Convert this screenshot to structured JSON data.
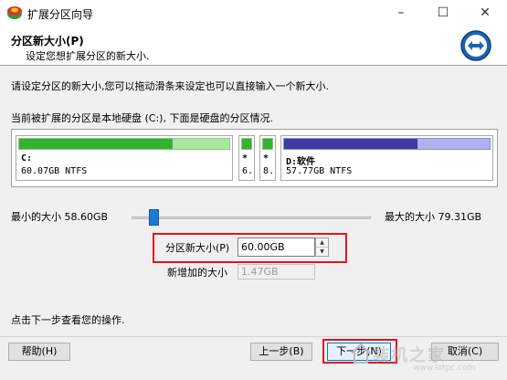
{
  "window": {
    "title": "扩展分区向导"
  },
  "titlebar_buttons": {
    "minimize": "–",
    "maximize": "☐",
    "close": "✕"
  },
  "header": {
    "title": "分区新大小(P)",
    "subtitle": "设定您想扩展分区的新大小."
  },
  "content": {
    "instruction": "请设定分区的新大小,您可以拖动滑条来设定也可以直接输入一个新大小.",
    "status": "当前被扩展的分区是本地硬盘 (C:), 下面是硬盘的分区情况.",
    "footer_note": "点击下一步查看您的操作."
  },
  "partitions": [
    {
      "name": "C:",
      "info": "60.07GB NTFS",
      "used_pct": 73,
      "color": "green"
    },
    {
      "name": "*",
      "info": "6.",
      "used_pct": 100,
      "color": "green"
    },
    {
      "name": "*",
      "info": "8.",
      "used_pct": 100,
      "color": "green"
    },
    {
      "name": "D:软件",
      "info": "57.77GB NTFS",
      "used_pct": 65,
      "color": "blue"
    }
  ],
  "slider": {
    "min_label": "最小的大小 58.60GB",
    "max_label": "最大的大小 79.31GB"
  },
  "size": {
    "label": "分区新大小(P)",
    "value": "60.00GB",
    "added_label": "新增加的大小",
    "added_value": "1.47GB"
  },
  "buttons": {
    "help": "帮助(H)",
    "back": "上一步(B)",
    "next": "下一步(N)",
    "cancel": "取消(C)"
  },
  "watermark": {
    "text": "装机之家",
    "url": "www.lotpc.com"
  }
}
